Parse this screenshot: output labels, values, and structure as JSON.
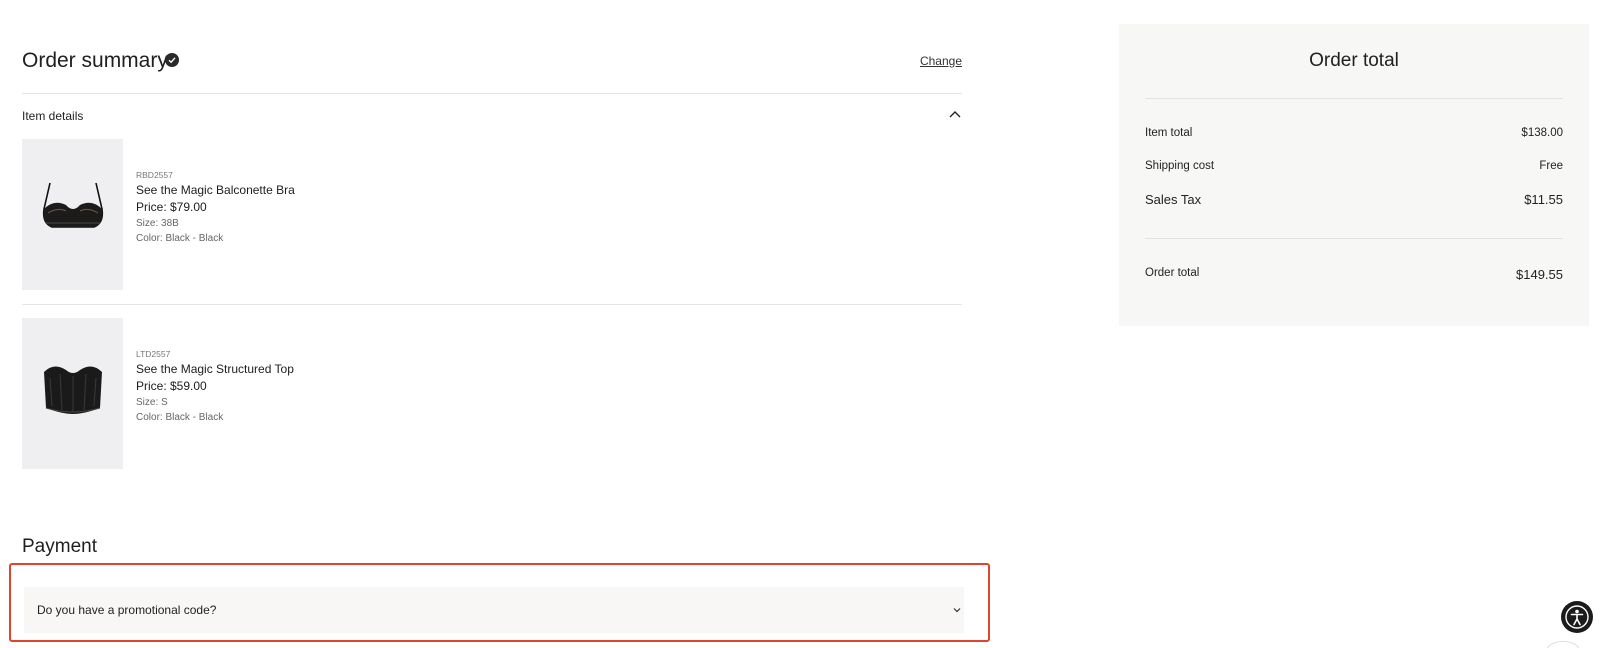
{
  "order_summary": {
    "title": "Order summary",
    "change_label": "Change",
    "item_details_label": "Item details",
    "items": [
      {
        "sku": "RBD2557",
        "name": "See the Magic Balconette Bra",
        "price": "Price: $79.00",
        "size": "Size: 38B",
        "color": "Color: Black - Black",
        "image_icon": "bra-product-image"
      },
      {
        "sku": "LTD2557",
        "name": "See the Magic Structured Top",
        "price": "Price: $59.00",
        "size": "Size: S",
        "color": "Color: Black - Black",
        "image_icon": "structured-top-product-image"
      }
    ]
  },
  "payment": {
    "title": "Payment",
    "promo_label": "Do you have a promotional code?"
  },
  "order_total": {
    "title": "Order total",
    "rows": [
      {
        "label": "Item total",
        "value": "$138.00"
      },
      {
        "label": "Shipping cost",
        "value": "Free"
      },
      {
        "label": "Sales Tax",
        "value": "$11.55"
      }
    ],
    "total_label": "Order total",
    "total_value": "$149.55"
  },
  "colors": {
    "highlight_border": "#e0452c",
    "panel_background": "#f7f7f5",
    "image_background": "#efeff1"
  }
}
